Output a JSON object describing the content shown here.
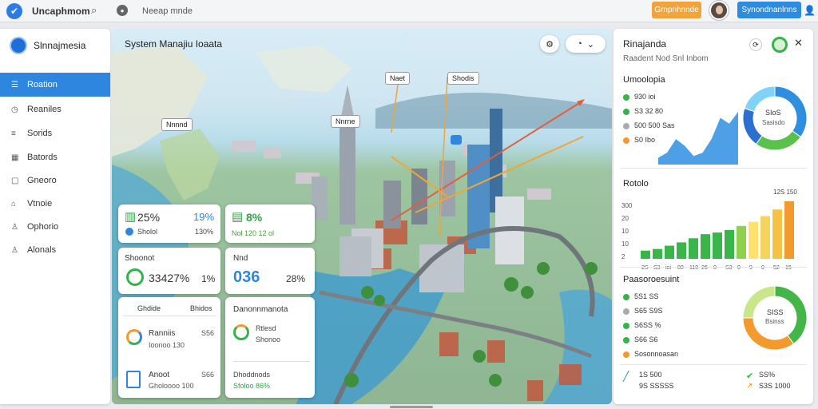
{
  "topbar": {
    "app_name": "Uncaphmom",
    "crumb": "Neeap mnde",
    "orange_button": "Grnpnhnnde",
    "blue_button": "Synondnanlnns"
  },
  "sidebar": {
    "title": "Slnnajmesia",
    "items": [
      {
        "label": "Roation",
        "icon": "menu-icon",
        "active": true
      },
      {
        "label": "Reaniles",
        "icon": "clock-icon"
      },
      {
        "label": "Sorids",
        "icon": "list-icon"
      },
      {
        "label": "Batords",
        "icon": "grid-icon"
      },
      {
        "label": "Gneoro",
        "icon": "square-icon"
      },
      {
        "label": "Vtnoie",
        "icon": "home-icon"
      },
      {
        "label": "Ophorio",
        "icon": "user-icon"
      },
      {
        "label": "Alonals",
        "icon": "user-icon"
      }
    ]
  },
  "map": {
    "title": "System Manajiu Ioaata",
    "tags": [
      "Naet",
      "Shodis",
      "Nnnnd",
      "Nnrne"
    ],
    "cards": {
      "c1": {
        "big_left": "25%",
        "big_right": "19%",
        "sub_left": "Sholol",
        "sub_right": "130%"
      },
      "c2": {
        "big": "8%",
        "sub": "Nol 120 12 ol"
      },
      "c3": {
        "label": "Shoonot",
        "big_left": "33427%",
        "big_right": "1%"
      },
      "c4": {
        "label": "Nnd",
        "big_left": "036",
        "big_right": "28%"
      },
      "c5": {
        "h_left": "Ghdide",
        "h_right": "Bhidos",
        "r1_title": "Ranniis",
        "r1_val": "S56",
        "r1_sub": "Ioonoo 130",
        "r2_title": "Anoot",
        "r2_val": "S66",
        "r2_sub": "Gholoooo 100"
      },
      "c6": {
        "h": "Danonnmanota",
        "r1a": "Rtlesd",
        "r1b": "Shonoo",
        "r2a": "Dhoddnods",
        "r2b": "Sfoloo 86%"
      }
    }
  },
  "panel": {
    "title": "Rinajanda",
    "subtitle": "Raadent Nod Snl Inbom",
    "s1_title": "Umoolopia",
    "s1_legend": [
      {
        "label": "930 ioi",
        "color": "#33b44a"
      },
      {
        "label": "S3 32 80",
        "color": "#33b44a"
      },
      {
        "label": "500 500 Sas",
        "color": "#aaaaaa"
      },
      {
        "label": "S0 Ibo",
        "color": "#f29a2e"
      }
    ],
    "s1_area": [
      8,
      14,
      30,
      22,
      10,
      14,
      30,
      55,
      48,
      62
    ],
    "s1_donut_label": "SIoS",
    "s1_donut_sub": "Sasisdo",
    "s1_donut": [
      {
        "value": 35,
        "color": "#2e8fe0"
      },
      {
        "value": 25,
        "color": "#59c24a"
      },
      {
        "value": 20,
        "color": "#2c6fd0"
      },
      {
        "value": 20,
        "color": "#7fd3f7"
      }
    ],
    "s2_title": "Rotolo",
    "s2_top_label": "12S 150",
    "s2_ticks": [
      "300",
      "20",
      "10",
      "10",
      "2"
    ],
    "s2_bars": [
      10,
      12,
      16,
      20,
      25,
      30,
      32,
      35,
      40,
      45,
      52,
      60,
      70
    ],
    "s2_bar_colors": [
      "#3ab549",
      "#3ab549",
      "#3ab549",
      "#3ab549",
      "#3ab549",
      "#3ab549",
      "#3ab549",
      "#3ab549",
      "#8fd14f",
      "#ffe16b",
      "#f6d35d",
      "#f6c245",
      "#f29a2e"
    ],
    "s2_x_labels": [
      "2S",
      "S3",
      "ioi",
      "80",
      "110",
      "26",
      "0",
      "S3",
      "0",
      "9",
      "0",
      "52",
      "15"
    ],
    "s3_title": "Paasoroesuint",
    "s3_legend": [
      {
        "label": "5S1 SS",
        "color": "#33b44a"
      },
      {
        "label": "S65 S9S",
        "color": "#aaaaaa"
      },
      {
        "label": "S6SS %",
        "color": "#33b44a"
      },
      {
        "label": "S66 S6",
        "color": "#33b44a"
      },
      {
        "label": "Sosonnoasan",
        "color": "#f29a2e"
      }
    ],
    "s3_donut_label": "SISS",
    "s3_donut_sub": "Bsinss",
    "s3_donut": [
      {
        "value": 40,
        "color": "#44b649"
      },
      {
        "value": 35,
        "color": "#f39a2e"
      },
      {
        "value": 25,
        "color": "#c8e68a"
      }
    ],
    "foot": {
      "l1": "1S 500",
      "l2": "9S SSSSS",
      "r1": "SS%",
      "r2": "S3S 1000"
    }
  }
}
